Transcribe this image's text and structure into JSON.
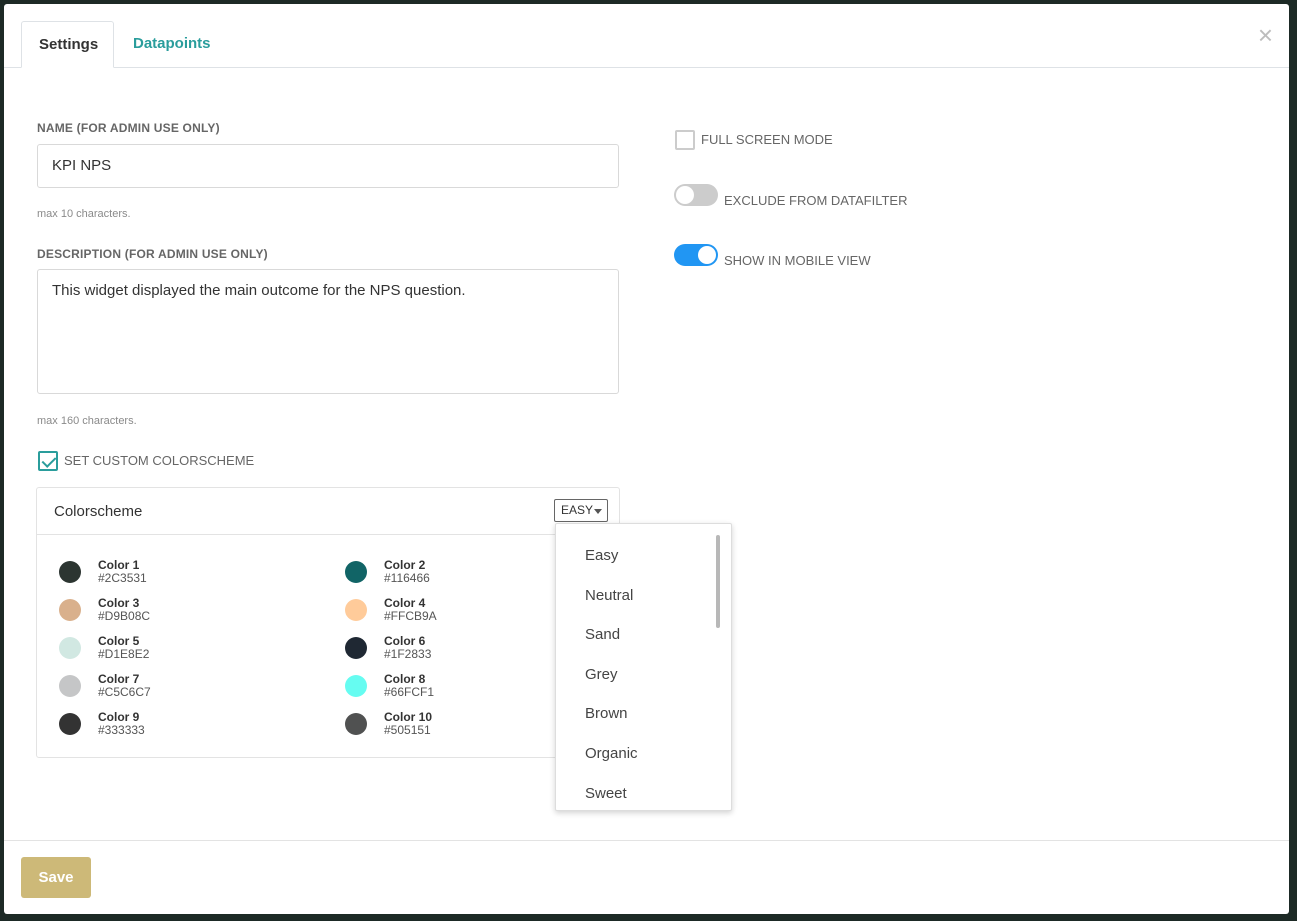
{
  "tabs": {
    "settings": "Settings",
    "datapoints": "Datapoints"
  },
  "close_icon": "×",
  "name": {
    "label": "NAME (FOR ADMIN USE ONLY)",
    "value": "KPI NPS",
    "hint": "max 10 characters."
  },
  "description": {
    "label": "DESCRIPTION (FOR ADMIN USE ONLY)",
    "value": "This widget displayed the main outcome for the NPS question.",
    "hint": "max 160 characters."
  },
  "custom_colorscheme": {
    "label": "SET CUSTOM COLORSCHEME",
    "checked": true
  },
  "options": {
    "full_screen": {
      "label": "FULL SCREEN MODE",
      "checked": false
    },
    "exclude_datafilter": {
      "label": "EXCLUDE FROM DATAFILTER",
      "on": false
    },
    "mobile_view": {
      "label": "SHOW IN MOBILE VIEW",
      "on": true
    }
  },
  "colorscheme": {
    "title": "Colorscheme",
    "selected": "EASY",
    "colors": [
      {
        "name": "Color 1",
        "hex": "#2C3531"
      },
      {
        "name": "Color 2",
        "hex": "#116466"
      },
      {
        "name": "Color 3",
        "hex": "#D9B08C"
      },
      {
        "name": "Color 4",
        "hex": "#FFCB9A"
      },
      {
        "name": "Color 5",
        "hex": "#D1E8E2"
      },
      {
        "name": "Color 6",
        "hex": "#1F2833"
      },
      {
        "name": "Color 7",
        "hex": "#C5C6C7"
      },
      {
        "name": "Color 8",
        "hex": "#66FCF1"
      },
      {
        "name": "Color 9",
        "hex": "#333333"
      },
      {
        "name": "Color 10",
        "hex": "#505151"
      }
    ],
    "options": [
      "Easy",
      "Neutral",
      "Sand",
      "Grey",
      "Brown",
      "Organic",
      "Sweet"
    ]
  },
  "footer": {
    "save_label": "Save"
  },
  "accent_colors": {
    "teal": "#2a9d9c",
    "toggle_on": "#2196f3",
    "save_button": "#cdb978"
  }
}
